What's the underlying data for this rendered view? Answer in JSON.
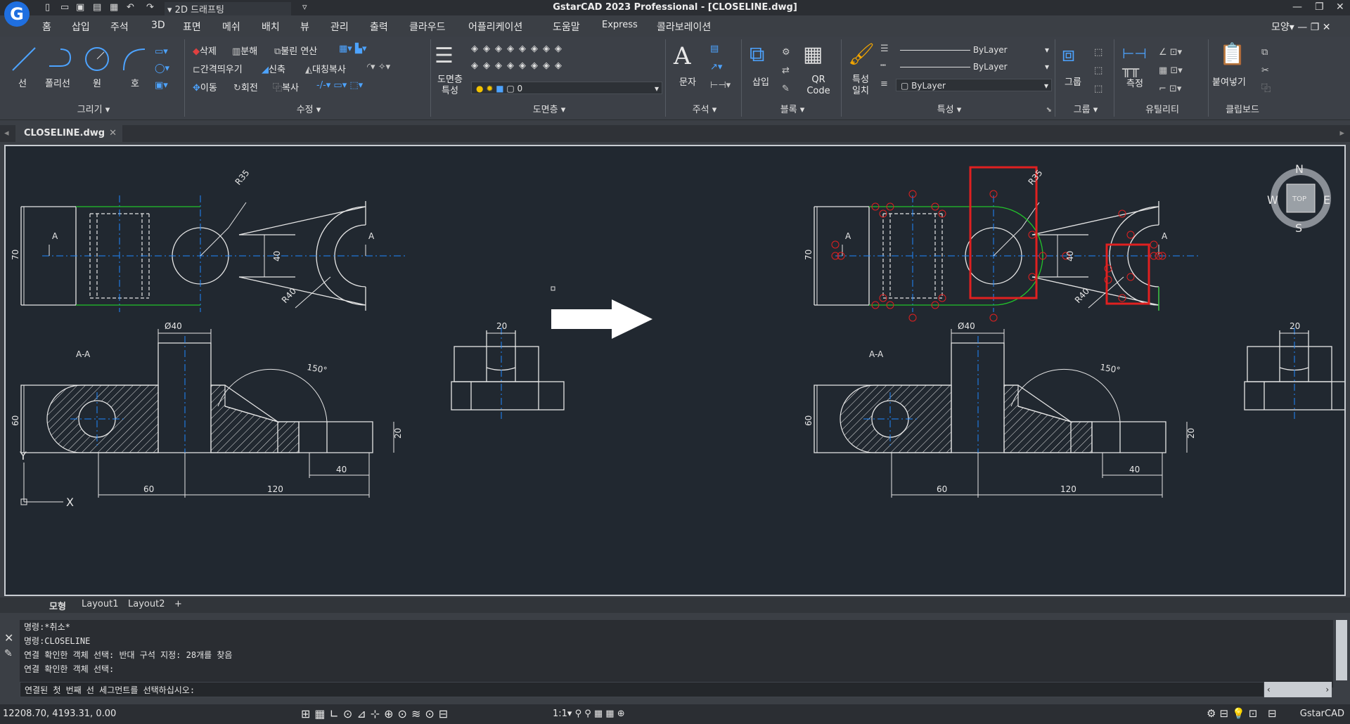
{
  "app": {
    "title": "GstarCAD 2023 Professional - [CLOSELINE.dwg]",
    "logo_letter": "G",
    "workspace": "2D 드래프팅",
    "style_menu": "모양"
  },
  "menu": [
    "홈",
    "삽입",
    "주석",
    "3D",
    "표면",
    "메쉬",
    "배치",
    "뷰",
    "관리",
    "출력",
    "클라우드",
    "어플리케이션",
    "도움말",
    "Express",
    "콜라보레이션"
  ],
  "ribbon": {
    "draw": {
      "label": "그리기",
      "line": "선",
      "polyline": "폴리선",
      "circle": "원",
      "arc": "호"
    },
    "modify": {
      "label": "수정",
      "erase": "삭제",
      "explode": "분해",
      "boolean": "불린 연산",
      "offset": "간격띄우기",
      "scale": "신축",
      "mirror": "대칭복사",
      "move": "이동",
      "rotate": "회전",
      "copy": "복사"
    },
    "layer": {
      "label": "도면층",
      "props": "도면층 특성",
      "current": "0"
    },
    "annotation": {
      "label": "주석",
      "text": "문자"
    },
    "block": {
      "label": "블록",
      "insert": "삽입",
      "qr": "QR Code"
    },
    "properties": {
      "label": "특성",
      "match": "특성 일치",
      "color": "ByLayer",
      "linetype": "ByLayer",
      "lineweight": "ByLayer"
    },
    "group": {
      "label": "그룹",
      "group": "그룹"
    },
    "utilities": {
      "label": "유틸리티",
      "measure": "측정"
    },
    "clipboard": {
      "label": "클립보드",
      "paste": "붙여넣기"
    }
  },
  "document_tab": "CLOSELINE.dwg",
  "layout_tabs": [
    "모형",
    "Layout1",
    "Layout2",
    "+"
  ],
  "drawing": {
    "dims": {
      "r35": "R35",
      "r40": "R40",
      "d70": "70",
      "d40": "40",
      "section": "A",
      "section_title": "A-A",
      "dia40": "Ø40",
      "d20": "20",
      "d60": "60",
      "angle": "150°",
      "d20b": "20",
      "d40b": "40",
      "d60b": "60",
      "d120": "120"
    },
    "ucs": {
      "x": "X",
      "y": "Y"
    },
    "viewcube": {
      "n": "N",
      "s": "S",
      "e": "E",
      "w": "W",
      "top": "TOP"
    }
  },
  "command": {
    "lines": [
      "명령:*취소*",
      "명령:CLOSELINE",
      "연결 확인한 객체 선택: 반대 구석 지정: 28개를 찾음",
      "연결 확인한 객체 선택:"
    ],
    "prompt": "연결된 첫 번째 선 세그먼트를 선택하십시오:"
  },
  "status": {
    "coords": "12208.70, 4193.31, 0.00",
    "scale": "1:1",
    "app_name": "GstarCAD"
  },
  "colors": {
    "background": "#212830",
    "accent": "#1f6fe0",
    "highlight": "#e02020",
    "green": "#22c32b",
    "blue": "#1e88ff"
  }
}
